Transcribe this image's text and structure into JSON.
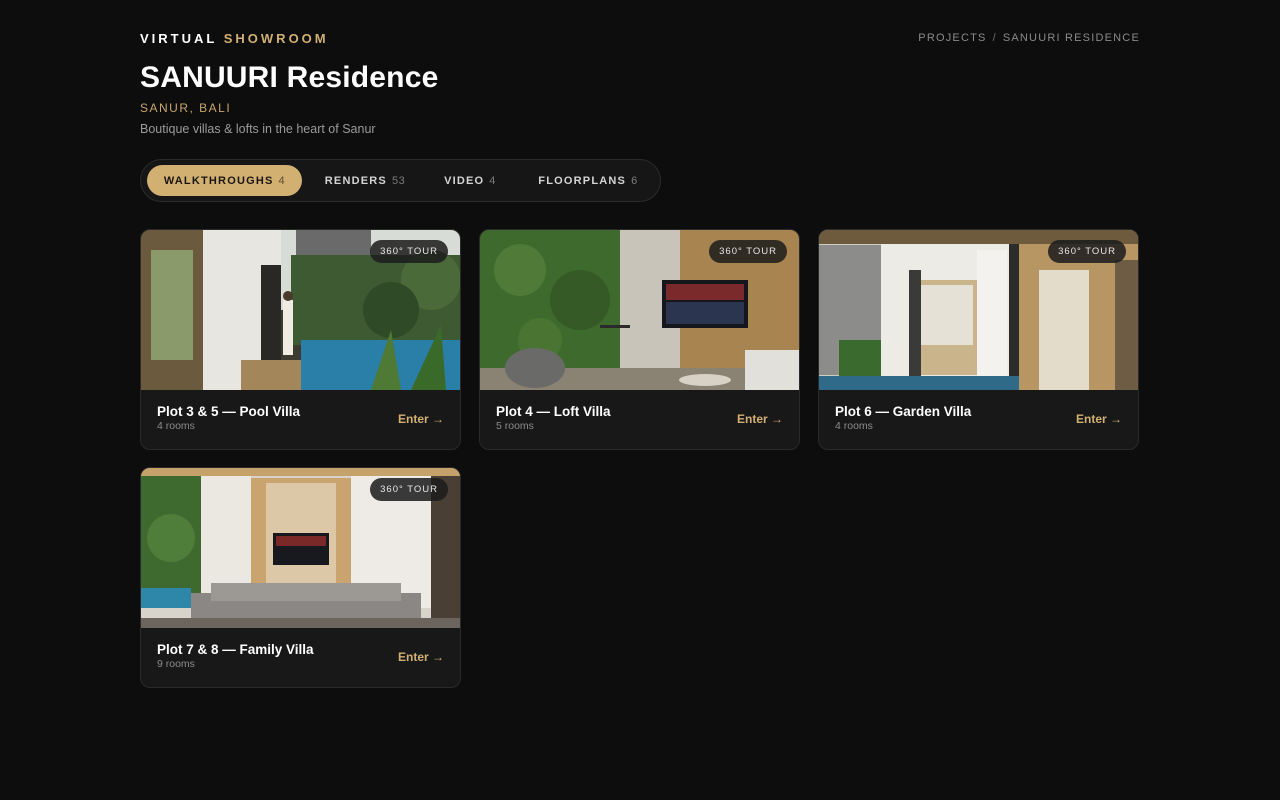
{
  "header": {
    "brand_primary": "VIRTUAL",
    "brand_accent": "SHOWROOM",
    "breadcrumb": [
      "PROJECTS",
      "SANUURI RESIDENCE"
    ],
    "breadcrumb_separator": "/",
    "title": "SANUURI Residence",
    "location": "SANUR, BALI",
    "tagline": "Boutique villas & lofts in the heart of Sanur"
  },
  "tabs": [
    {
      "label": "WALKTHROUGHS",
      "count": "4",
      "active": true
    },
    {
      "label": "RENDERS",
      "count": "53",
      "active": false
    },
    {
      "label": "VIDEO",
      "count": "4",
      "active": false
    },
    {
      "label": "FLOORPLANS",
      "count": "6",
      "active": false
    }
  ],
  "cards": [
    {
      "title": "Plot 3 & 5 — Pool Villa",
      "rooms": "4 rooms",
      "badge": "360° TOUR",
      "action": "Enter →",
      "scene": "pool-villa"
    },
    {
      "title": "Plot 4 — Loft Villa",
      "rooms": "5 rooms",
      "badge": "360° TOUR",
      "action": "Enter →",
      "scene": "loft-villa"
    },
    {
      "title": "Plot 6 — Garden Villa",
      "rooms": "4 rooms",
      "badge": "360° TOUR",
      "action": "Enter →",
      "scene": "garden-villa"
    },
    {
      "title": "Plot 7 & 8 — Family Villa",
      "rooms": "9 rooms",
      "badge": "360° TOUR",
      "action": "Enter →",
      "scene": "family-villa"
    }
  ],
  "colors": {
    "background": "#0d0d0d",
    "accent": "#d2b072",
    "card": "#181818"
  }
}
